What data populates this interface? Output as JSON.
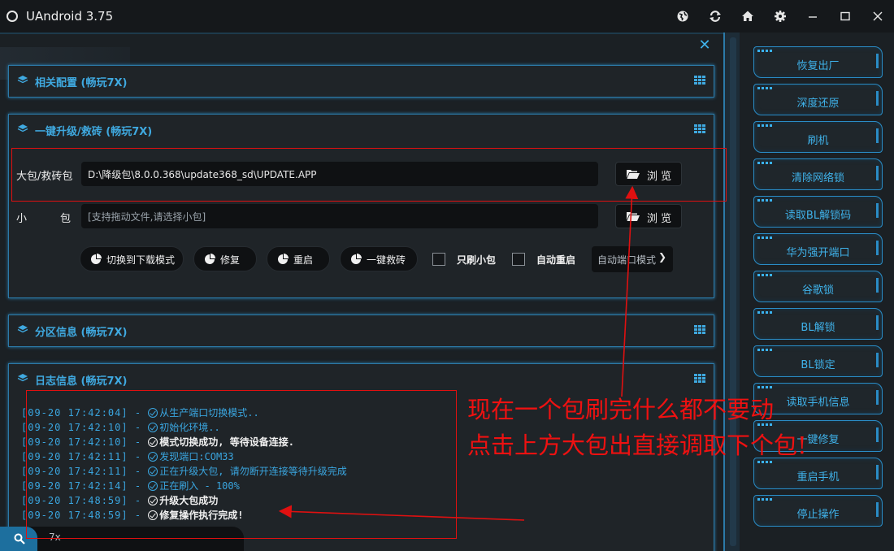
{
  "window": {
    "title": "UAndroid 3.75",
    "icons": [
      "globe-icon",
      "refresh-icon",
      "home-icon",
      "gear-icon",
      "minimize-icon",
      "maximize-icon",
      "close-icon"
    ]
  },
  "panels": {
    "config": {
      "title": "相关配置 (畅玩7X)"
    },
    "upgrade": {
      "title": "一键升级/救砖 (畅玩7X)",
      "big_pkg_label": "大包/救砖包",
      "big_pkg_value": "D:\\降级包\\8.0.0.368\\update368_sd\\UPDATE.APP",
      "small_pkg_label_1": "小",
      "small_pkg_label_2": "包",
      "small_pkg_placeholder": "[支持拖动文件,请选择小包]",
      "browse_label": "浏 览",
      "actions": [
        "切换到下载模式",
        "修复",
        "重启",
        "一键救砖"
      ],
      "checkbox_small_only": "只刷小包",
      "checkbox_auto_reboot": "自动重启",
      "port_mode": "自动端口模式"
    },
    "partition": {
      "title": "分区信息 (畅玩7X)"
    },
    "log": {
      "title": "日志信息 (畅玩7X)"
    }
  },
  "log_lines": [
    {
      "time": "[09-20 17:42:04] - ",
      "msg": "从生产端口切换模式..",
      "white": false
    },
    {
      "time": "[09-20 17:42:10] - ",
      "msg": "初始化环境..",
      "white": false
    },
    {
      "time": "[09-20 17:42:10] - ",
      "msg": "模式切换成功, 等待设备连接.",
      "white": true
    },
    {
      "time": "[09-20 17:42:11] - ",
      "msg": "发现端口:COM33",
      "white": false
    },
    {
      "time": "[09-20 17:42:11] - ",
      "msg": "正在升级大包, 请勿断开连接等待升级完成",
      "white": false
    },
    {
      "time": "[09-20 17:42:14] - ",
      "msg": "正在刷入 - 100%",
      "white": false
    },
    {
      "time": "[09-20 17:48:59] - ",
      "msg": "升级大包成功",
      "white": true
    },
    {
      "time": "[09-20 17:48:59] - ",
      "msg": "修复操作执行完成!",
      "white": true
    }
  ],
  "search": {
    "value": "7x"
  },
  "sidebar": {
    "items": [
      {
        "label": "恢复出厂"
      },
      {
        "label": "深度还原"
      },
      {
        "label": "刷机"
      },
      {
        "label": "清除网络锁"
      },
      {
        "label": "读取BL解锁码"
      },
      {
        "label": "华为强开端口"
      },
      {
        "label": "谷歌锁"
      },
      {
        "label": "BL解锁"
      },
      {
        "label": "BL锁定"
      },
      {
        "label": "读取手机信息"
      },
      {
        "label": "一键修复"
      },
      {
        "label": "重启手机"
      },
      {
        "label": "停止操作"
      }
    ]
  },
  "annotation": {
    "line1": "现在一个包刷完什么都不要动",
    "line2": "点击上方大包出直接调取下个包!"
  },
  "colors": {
    "accent": "#3fa9e0",
    "panel_border": "#2c7aa8",
    "annotation": "#ee1111"
  }
}
